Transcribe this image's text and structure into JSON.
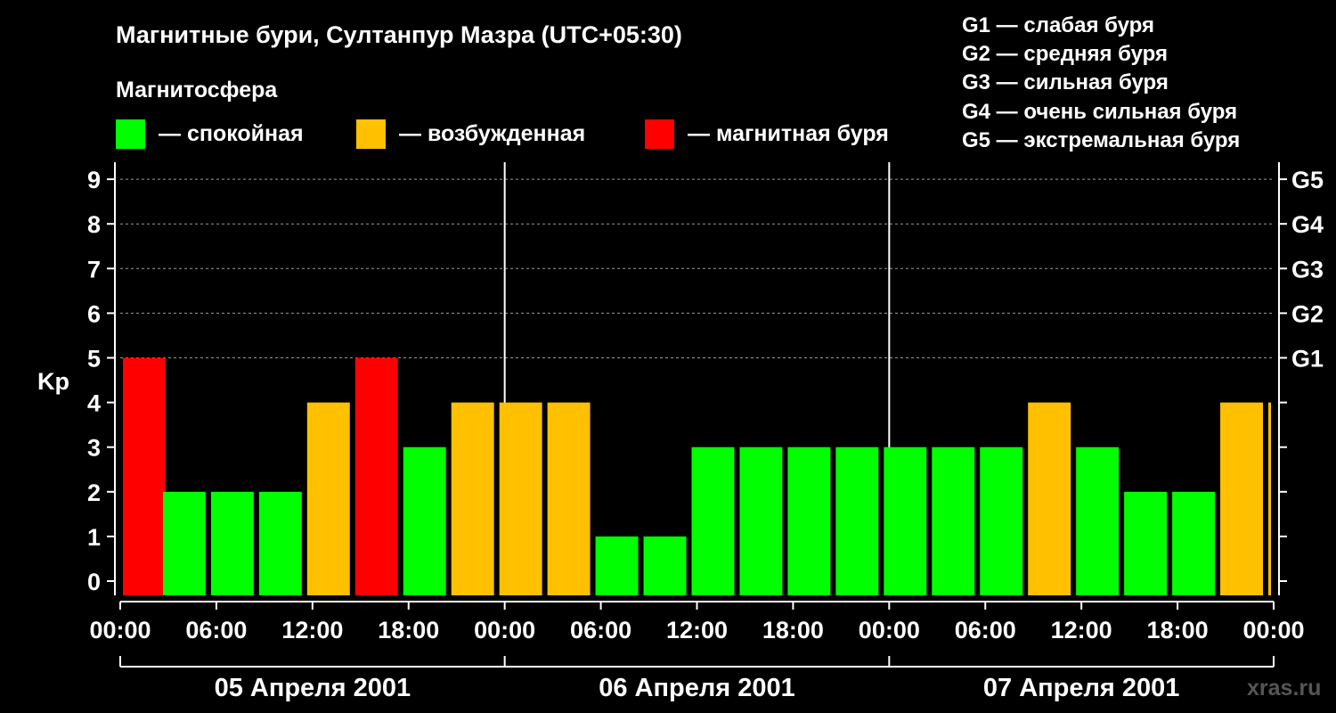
{
  "title": "Магнитные бури, Султанпур Мазра (UTC+05:30)",
  "legend_title": "Магнитосфера",
  "legend": [
    {
      "label": "— спокойная",
      "color": "#00ff00"
    },
    {
      "label": "— возбужденная",
      "color": "#ffc000"
    },
    {
      "label": "— магнитная буря",
      "color": "#ff0000"
    }
  ],
  "g_scale": [
    "G1 — слабая буря",
    "G2 — средняя буря",
    "G3 — сильная буря",
    "G4 — очень сильная буря",
    "G5 — экстремальная буря"
  ],
  "brand": "xras.ru",
  "chart_data": {
    "type": "bar",
    "ylabel": "Kp",
    "ylim": [
      0,
      9
    ],
    "yticks": [
      "0",
      "1",
      "2",
      "3",
      "4",
      "5",
      "6",
      "7",
      "8",
      "9"
    ],
    "right_ticks": [
      {
        "value": 5,
        "label": "G1"
      },
      {
        "value": 6,
        "label": "G2"
      },
      {
        "value": 7,
        "label": "G3"
      },
      {
        "value": 8,
        "label": "G4"
      },
      {
        "value": 9,
        "label": "G5"
      }
    ],
    "xticks": [
      "00:00",
      "06:00",
      "12:00",
      "18:00",
      "00:00",
      "06:00",
      "12:00",
      "18:00",
      "00:00",
      "06:00",
      "12:00",
      "18:00",
      "00:00"
    ],
    "days": [
      "05 Апреля 2001",
      "06 Апреля 2001",
      "07 Апреля 2001"
    ],
    "bars": [
      {
        "start": "05 Апреля 2001 00:00",
        "kp": 5,
        "level": "магнитная буря"
      },
      {
        "start": "05 Апреля 2001 02:30",
        "kp": 2,
        "level": "спокойная"
      },
      {
        "start": "05 Апреля 2001 05:30",
        "kp": 2,
        "level": "спокойная"
      },
      {
        "start": "05 Апреля 2001 08:30",
        "kp": 2,
        "level": "спокойная"
      },
      {
        "start": "05 Апреля 2001 11:30",
        "kp": 4,
        "level": "возбужденная"
      },
      {
        "start": "05 Апреля 2001 14:30",
        "kp": 5,
        "level": "магнитная буря"
      },
      {
        "start": "05 Апреля 2001 17:30",
        "kp": 3,
        "level": "спокойная"
      },
      {
        "start": "05 Апреля 2001 20:30",
        "kp": 4,
        "level": "возбужденная"
      },
      {
        "start": "05 Апреля 2001 23:30",
        "kp": 4,
        "level": "возбужденная"
      },
      {
        "start": "06 Апреля 2001 02:30",
        "kp": 4,
        "level": "возбужденная"
      },
      {
        "start": "06 Апреля 2001 05:30",
        "kp": 1,
        "level": "спокойная"
      },
      {
        "start": "06 Апреля 2001 08:30",
        "kp": 1,
        "level": "спокойная"
      },
      {
        "start": "06 Апреля 2001 11:30",
        "kp": 3,
        "level": "спокойная"
      },
      {
        "start": "06 Апреля 2001 14:30",
        "kp": 3,
        "level": "спокойная"
      },
      {
        "start": "06 Апреля 2001 17:30",
        "kp": 3,
        "level": "спокойная"
      },
      {
        "start": "06 Апреля 2001 20:30",
        "kp": 3,
        "level": "спокойная"
      },
      {
        "start": "06 Апреля 2001 23:30",
        "kp": 3,
        "level": "спокойная"
      },
      {
        "start": "07 Апреля 2001 02:30",
        "kp": 3,
        "level": "спокойная"
      },
      {
        "start": "07 Апреля 2001 05:30",
        "kp": 3,
        "level": "спокойная"
      },
      {
        "start": "07 Апреля 2001 08:30",
        "kp": 4,
        "level": "возбужденная"
      },
      {
        "start": "07 Апреля 2001 11:30",
        "kp": 3,
        "level": "спокойная"
      },
      {
        "start": "07 Апреля 2001 14:30",
        "kp": 2,
        "level": "спокойная"
      },
      {
        "start": "07 Апреля 2001 17:30",
        "kp": 2,
        "level": "спокойная"
      },
      {
        "start": "07 Апреля 2001 20:30",
        "kp": 4,
        "level": "возбужденная"
      },
      {
        "start": "07 Апреля 2001 23:30",
        "kp": 4,
        "level": "возбужденная"
      }
    ],
    "grid": "dashed horizontal at G levels",
    "colors": {
      "спокойная": "#00ff00",
      "возбужденная": "#ffc000",
      "магнитная буря": "#ff0000"
    }
  }
}
